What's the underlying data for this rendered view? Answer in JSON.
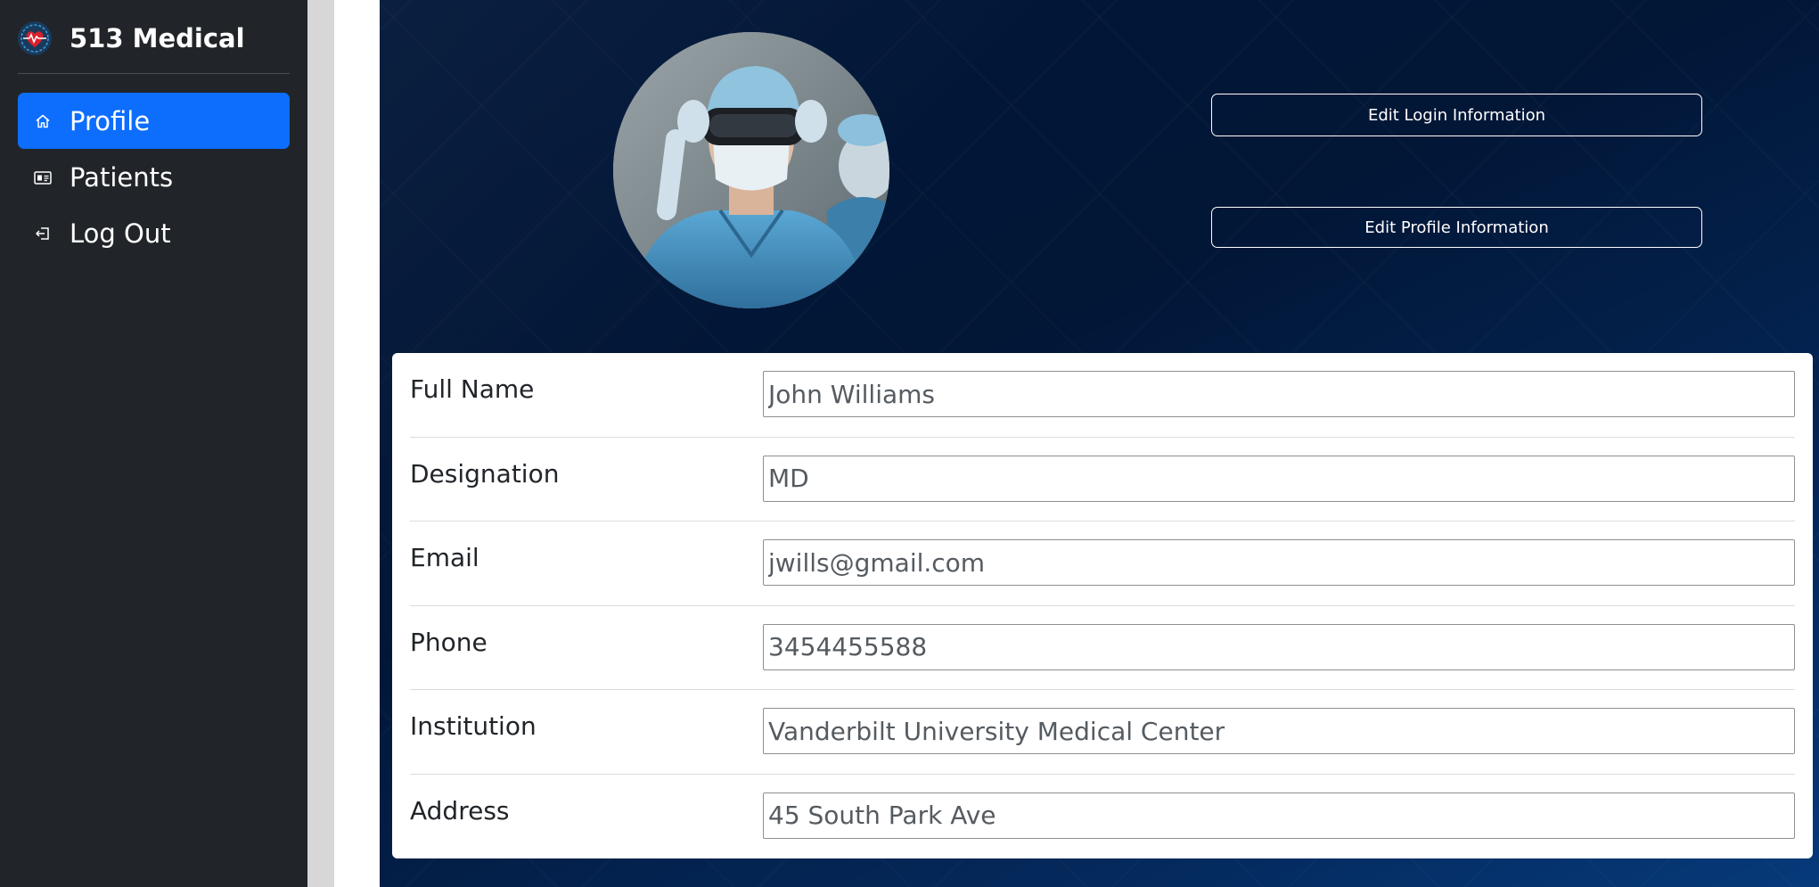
{
  "brand": {
    "name": "513 Medical",
    "logo_icon": "heart-logo-icon"
  },
  "sidebar": {
    "items": [
      {
        "label": "Profile",
        "icon": "home-icon",
        "active": true
      },
      {
        "label": "Patients",
        "icon": "id-card-icon",
        "active": false
      },
      {
        "label": "Log Out",
        "icon": "logout-icon",
        "active": false
      }
    ]
  },
  "hero": {
    "avatar_icon": "doctor-photo",
    "edit_login_label": "Edit Login Information",
    "edit_profile_label": "Edit Profile Information"
  },
  "profile": {
    "fields": [
      {
        "label": "Full Name",
        "value": "John Williams"
      },
      {
        "label": "Designation",
        "value": "MD"
      },
      {
        "label": "Email",
        "value": "jwills@gmail.com"
      },
      {
        "label": "Phone",
        "value": "3454455588"
      },
      {
        "label": "Institution",
        "value": "Vanderbilt University Medical Center"
      },
      {
        "label": "Address",
        "value": "45 South Park Ave"
      }
    ]
  },
  "colors": {
    "sidebar_bg": "#212529",
    "active_item": "#0d6efd",
    "hero_bg": "#021636"
  }
}
